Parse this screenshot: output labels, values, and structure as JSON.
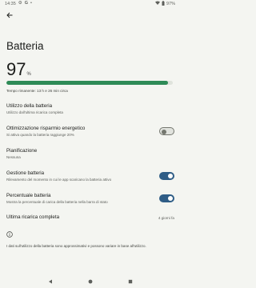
{
  "status_bar": {
    "time": "14:35",
    "battery_percent": "97%",
    "icons": [
      "settings-gear-icon",
      "google-g-icon",
      "dot-icon",
      "wifi-icon",
      "battery-icon"
    ]
  },
  "header": {
    "title": "Batteria"
  },
  "battery": {
    "level": "97",
    "unit": "%",
    "fill_fraction": 0.97,
    "bar_color": "#2e8b57",
    "time_remaining": "Tempo rimanente: 13 h e 26 min circa"
  },
  "settings": {
    "usage": {
      "title": "Utilizzo della batteria",
      "subtitle": "Utilizzo dall'ultima ricarica completa"
    },
    "saver": {
      "title": "Ottimizzazione risparmio energetico",
      "subtitle": "Si attiva quando la batteria raggiunge 20%",
      "enabled": false
    },
    "schedule": {
      "title": "Pianificazione",
      "subtitle": "Nessuna"
    },
    "manager": {
      "title": "Gestione batteria",
      "subtitle": "Rilevamento del momento in cui le app scaricano la batteria attivo",
      "enabled": true
    },
    "percentage": {
      "title": "Percentuale batteria",
      "subtitle": "Mostra la percentuale di carica della batteria nella barra di stato",
      "enabled": true
    },
    "last_charge": {
      "title": "Ultima ricarica completa",
      "value": "4 giorni fa"
    }
  },
  "footnote": "I dati sull'utilizzo della batteria sono approssimativi e possono variare in base all'utilizzo.",
  "colors": {
    "accent": "#2f5d86",
    "background": "#f4f5f1",
    "battery": "#2e8b57"
  }
}
